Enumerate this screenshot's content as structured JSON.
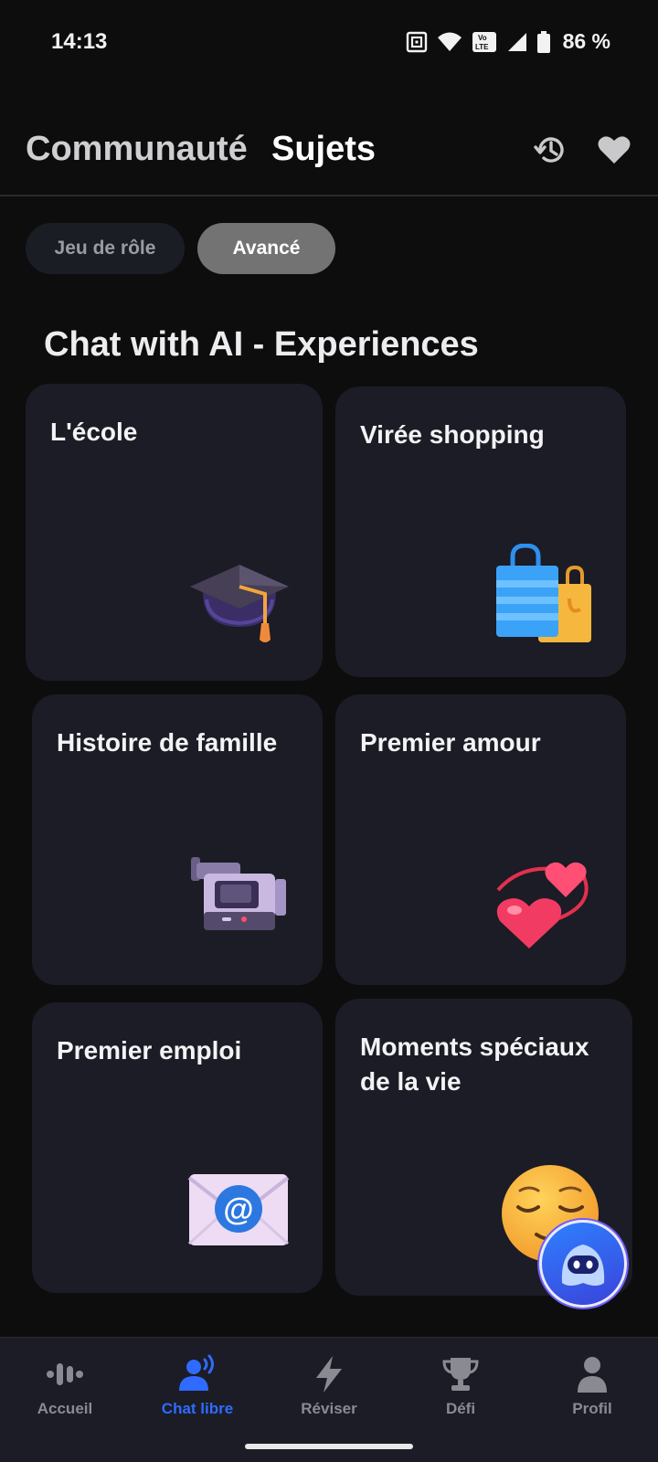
{
  "status_bar": {
    "time": "14:13",
    "battery": "86 %",
    "network": "VoLTE"
  },
  "header": {
    "tabs": [
      {
        "label": "Communauté",
        "active": false
      },
      {
        "label": "Sujets",
        "active": true
      }
    ],
    "icons": [
      "history-icon",
      "heart-icon"
    ]
  },
  "filters": [
    {
      "label": "Jeu de rôle",
      "selected": false
    },
    {
      "label": "Avancé",
      "selected": true
    }
  ],
  "section": {
    "title": "Chat with AI - Experiences"
  },
  "cards": [
    {
      "title": "L'école",
      "icon": "graduation-cap-icon"
    },
    {
      "title": "Virée shopping",
      "icon": "shopping-bags-icon"
    },
    {
      "title": "Histoire de famille",
      "icon": "video-camera-icon"
    },
    {
      "title": "Premier amour",
      "icon": "two-hearts-icon"
    },
    {
      "title": "Premier emploi",
      "icon": "email-envelope-icon"
    },
    {
      "title": "Moments spéciaux de la vie",
      "icon": "relieved-face-icon"
    }
  ],
  "bottom_nav": [
    {
      "label": "Accueil",
      "icon": "voice-wave-icon",
      "active": false
    },
    {
      "label": "Chat libre",
      "icon": "speaking-person-icon",
      "active": true
    },
    {
      "label": "Réviser",
      "icon": "lightning-icon",
      "active": false
    },
    {
      "label": "Défi",
      "icon": "trophy-icon",
      "active": false
    },
    {
      "label": "Profil",
      "icon": "person-icon",
      "active": false
    }
  ],
  "colors": {
    "background": "#0d0d0e",
    "card": "#1b1c25",
    "accent": "#2f6bff",
    "chip_selected": "#737373"
  }
}
